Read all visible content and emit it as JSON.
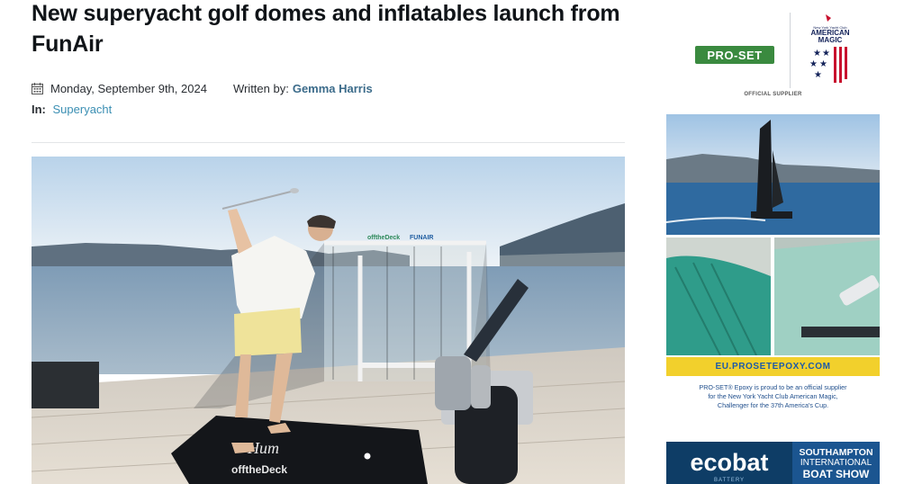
{
  "article": {
    "title": "New superyacht golf domes and inflatables launch from FunAir",
    "date": "Monday, September 9th, 2024",
    "written_by_label": "Written by:",
    "author": "Gemma Harris",
    "in_label": "In:",
    "category": "Superyacht",
    "hero_logos": [
      "offtheDeck",
      "FUNAIR"
    ],
    "mat_text": [
      "Hum",
      "offtheDeck"
    ]
  },
  "sidebar": {
    "ad1": {
      "brand": "PRO-SET",
      "partner_lines": [
        "New York Yacht Club",
        "AMERICAN",
        "MAGIC"
      ],
      "supplier_label": "OFFICIAL SUPPLIER"
    },
    "ad2": {
      "url": "EU.PROSETEPOXY.COM",
      "text_lines": [
        "PRO-SET® Epoxy is proud to be an official supplier",
        "for the New York Yacht Club American Magic,",
        "Challenger for the 37th America's Cup."
      ]
    },
    "ad3": {
      "brand": "ecobat",
      "brand_sub": "BATTERY",
      "show_lines": [
        "SOUTHAMPTON",
        "INTERNATIONAL",
        "BOAT SHOW"
      ]
    }
  },
  "colors": {
    "author_link": "#3b6b8a",
    "category_link": "#3b8fb3",
    "proset_green": "#3a8a3f",
    "epoxy_yellow": "#f2d02c",
    "ecobat_blue": "#0e3d66"
  }
}
